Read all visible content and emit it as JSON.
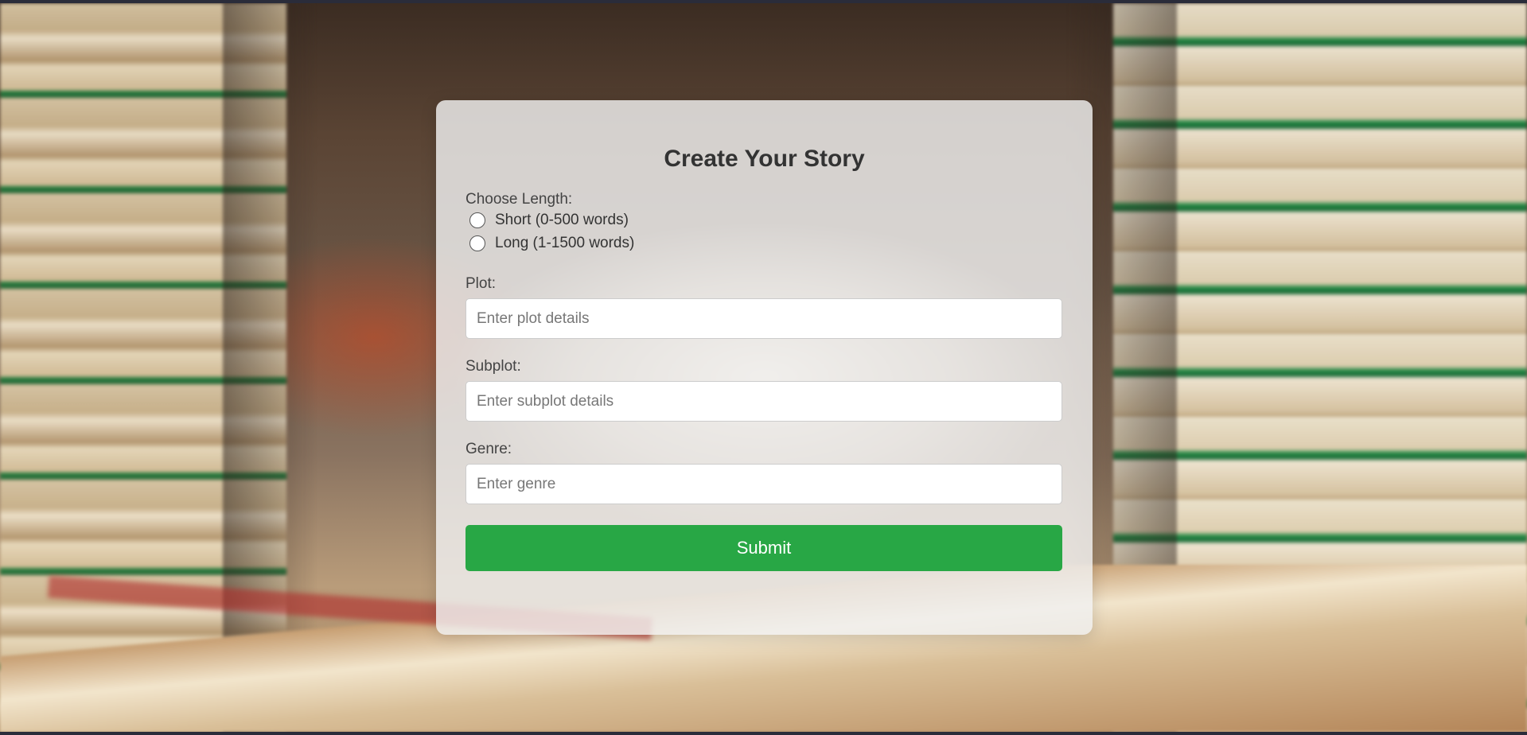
{
  "form": {
    "title": "Create Your Story",
    "length_label": "Choose Length:",
    "length_options": [
      {
        "label": "Short (0-500 words)",
        "selected": false
      },
      {
        "label": "Long (1-1500 words)",
        "selected": false
      }
    ],
    "plot_label": "Plot:",
    "plot_placeholder": "Enter plot details",
    "plot_value": "",
    "subplot_label": "Subplot:",
    "subplot_placeholder": "Enter subplot details",
    "subplot_value": "",
    "genre_label": "Genre:",
    "genre_placeholder": "Enter genre",
    "genre_value": "",
    "submit_label": "Submit"
  },
  "colors": {
    "submit_button": "#28a745",
    "card_background": "#f0f0f0",
    "title_text": "#333333"
  },
  "background": {
    "image": "books-background"
  }
}
